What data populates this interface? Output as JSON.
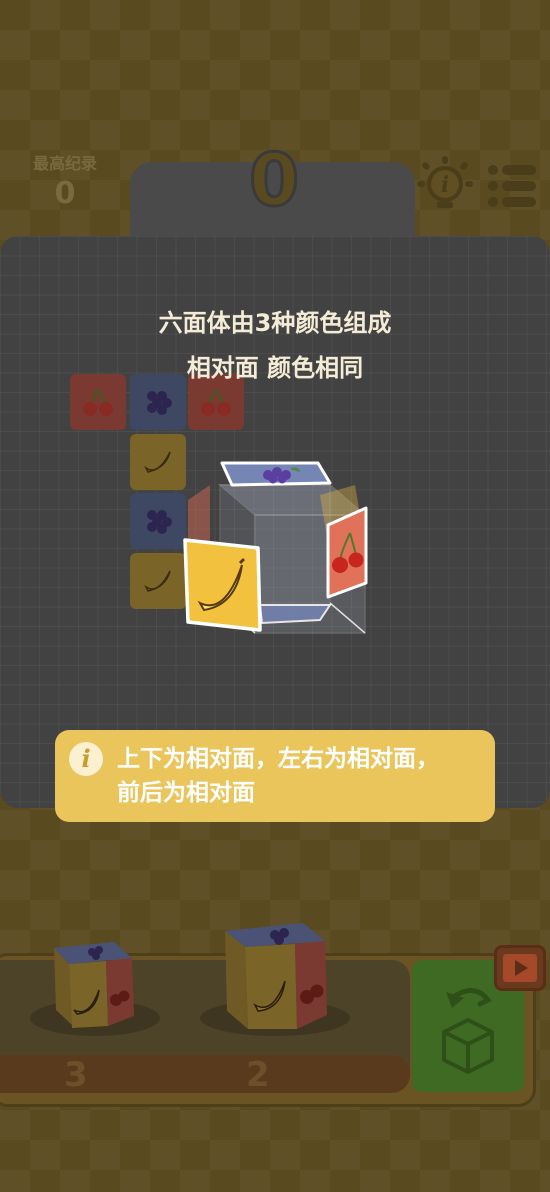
{
  "hud": {
    "best_label": "最高纪录",
    "best_value": "0",
    "score": "0"
  },
  "tutorial": {
    "title_line1": "六面体由3种颜色组成",
    "title_line2": "相对面 颜色相同",
    "tip_line1": "上下为相对面，左右为相对面，",
    "tip_line2": "前后为相对面"
  },
  "tray": {
    "piece_counts": [
      "3",
      "2"
    ]
  },
  "colors": {
    "red": "#e06d57",
    "blue": "#6f7fb0",
    "yellow": "#f0c043",
    "banner": "#e9c55c"
  },
  "icons": [
    "cherry-icon",
    "grape-icon",
    "banana-icon",
    "lightbulb-info-icon",
    "menu-icon",
    "undo-icon",
    "video-icon"
  ]
}
